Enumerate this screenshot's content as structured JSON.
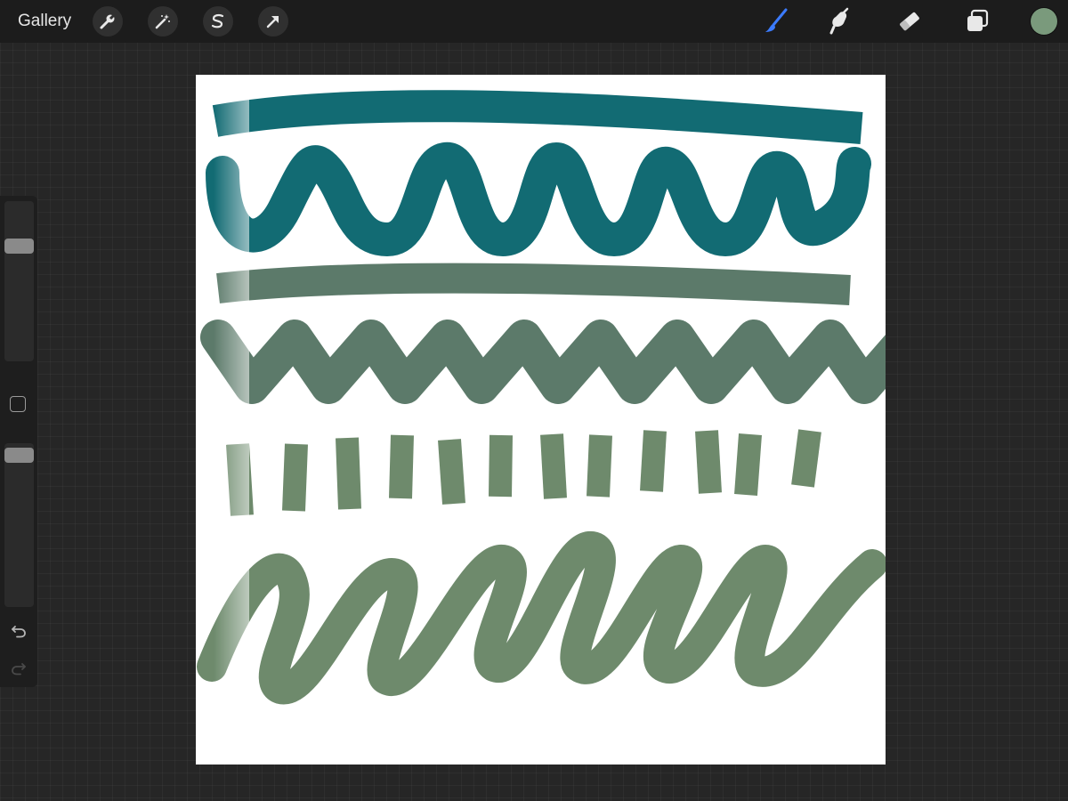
{
  "toolbar": {
    "gallery_label": "Gallery",
    "left_tools": [
      {
        "name": "actions",
        "icon": "wrench-icon"
      },
      {
        "name": "adjustments",
        "icon": "magic-wand-icon"
      },
      {
        "name": "selection",
        "icon": "selection-s-icon"
      },
      {
        "name": "transform",
        "icon": "arrow-cursor-icon"
      }
    ],
    "right_tools": [
      {
        "name": "brush",
        "icon": "brush-icon",
        "active": true
      },
      {
        "name": "smudge",
        "icon": "smudge-icon"
      },
      {
        "name": "eraser",
        "icon": "eraser-icon"
      },
      {
        "name": "layers",
        "icon": "layers-icon"
      }
    ],
    "current_color": "#7a9a7c"
  },
  "sidebar": {
    "brush_size_level": 0.26,
    "opacity_level": 0.03,
    "modify_button": "square-icon",
    "undo": "undo-icon",
    "redo": "redo-icon"
  },
  "colors": {
    "active_tool": "#3b7bff",
    "teal": "#126b73",
    "sage": "#5c7a6a",
    "green": "#6e8a6c"
  }
}
